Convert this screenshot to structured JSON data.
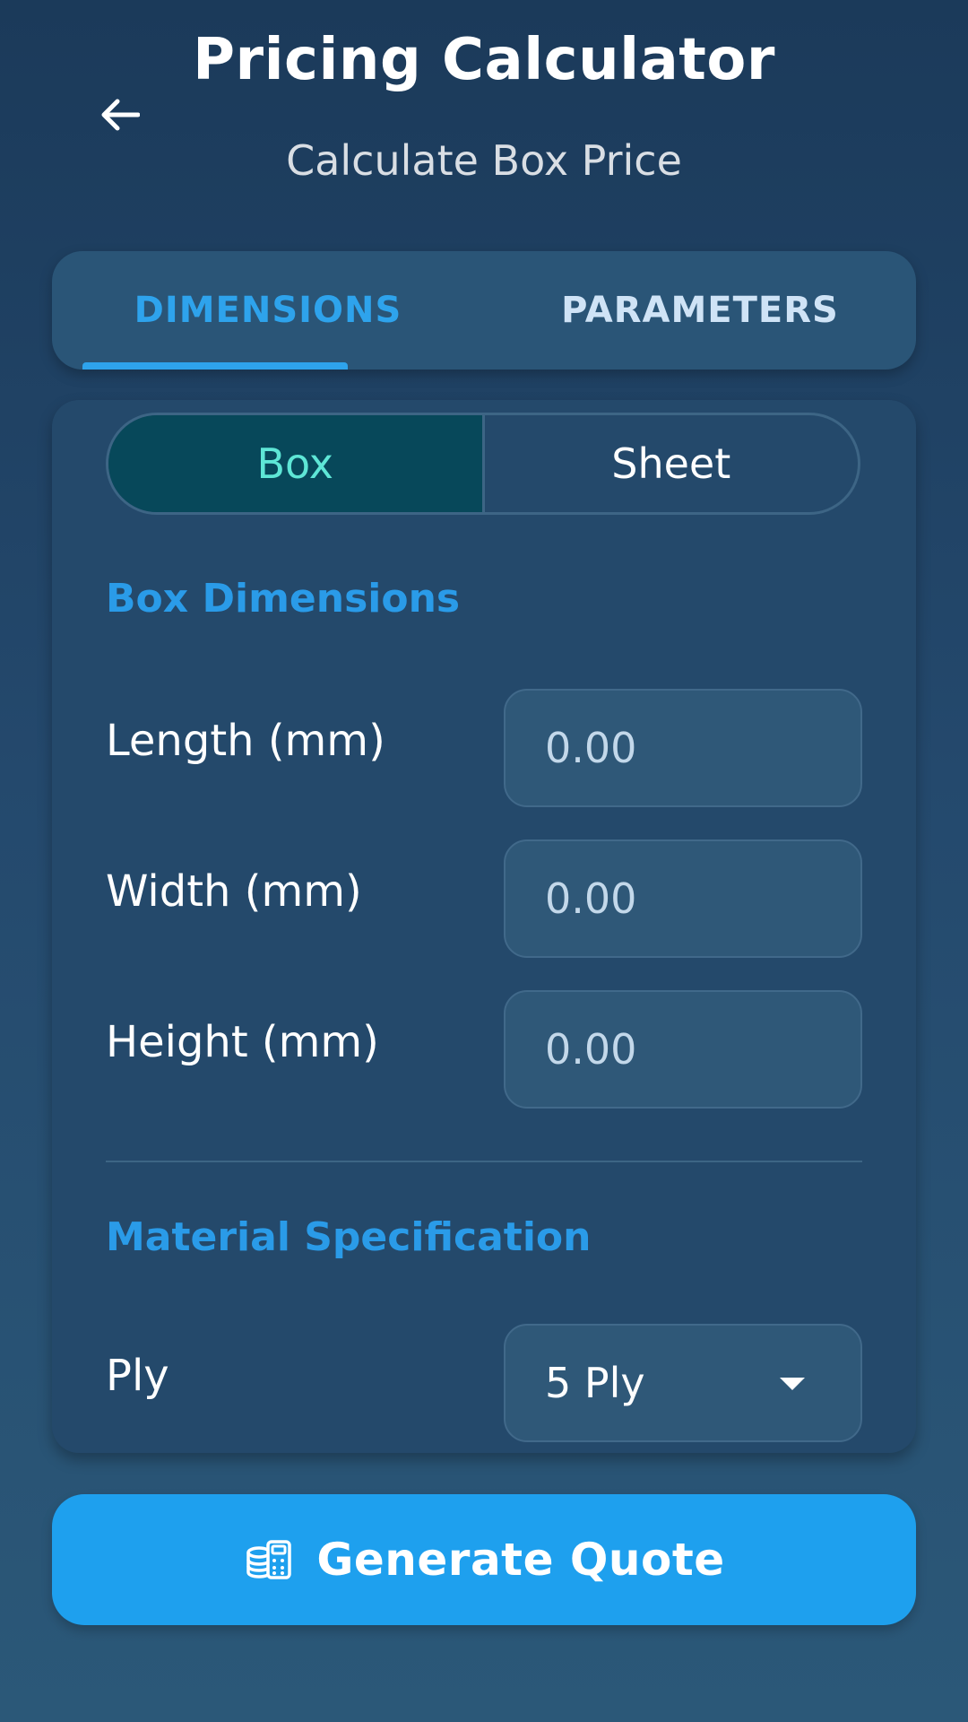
{
  "header": {
    "title": "Pricing Calculator",
    "subtitle": "Calculate Box Price",
    "back_icon": "arrow-left-icon"
  },
  "tabs": [
    {
      "label": "DIMENSIONS",
      "active": true
    },
    {
      "label": "PARAMETERS",
      "active": false
    }
  ],
  "mode_toggle": {
    "options": [
      "Box",
      "Sheet"
    ],
    "selected": "Box"
  },
  "box_dimensions": {
    "title": "Box Dimensions",
    "fields": [
      {
        "label": "Length (mm)",
        "placeholder": "0.00",
        "value": ""
      },
      {
        "label": "Width (mm)",
        "placeholder": "0.00",
        "value": ""
      },
      {
        "label": "Height (mm)",
        "placeholder": "0.00",
        "value": ""
      }
    ]
  },
  "material": {
    "title": "Material Specification",
    "ply_label": "Ply",
    "ply_value": "5 Ply"
  },
  "action": {
    "label": "Generate Quote",
    "icon": "calculator-coins-icon"
  },
  "colors": {
    "accent": "#1ea0ee",
    "tab_active": "#2ea3ec",
    "toggle_selected_bg": "#07485a",
    "toggle_selected_text": "#5ee6d6"
  }
}
